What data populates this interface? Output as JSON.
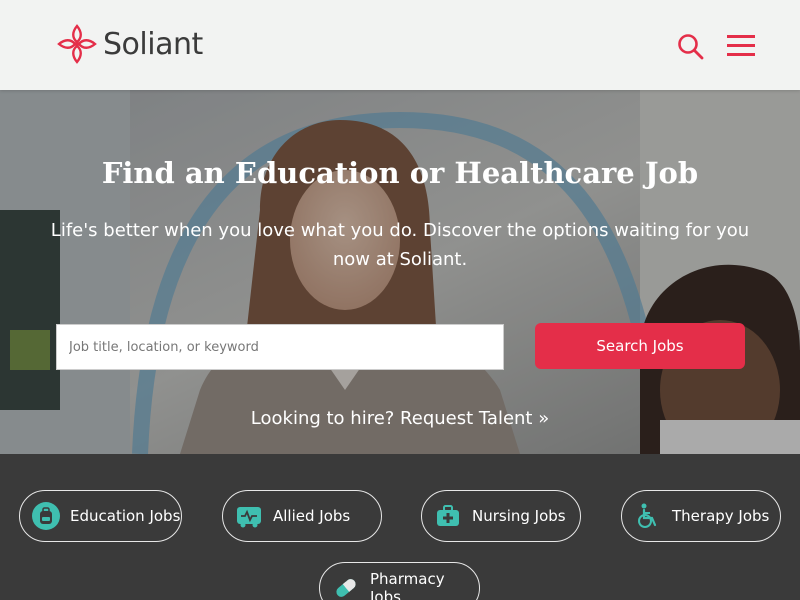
{
  "brand": {
    "name": "Soliant",
    "accent": "#e42e49",
    "teal": "#3fbfb0"
  },
  "header": {
    "search_icon": "search-icon",
    "menu_icon": "hamburger-menu-icon"
  },
  "hero": {
    "title": "Find an Education or Healthcare Job",
    "subtitle": "Life's better when you love what you do. Discover the options waiting for you now at Soliant.",
    "search": {
      "placeholder": "Job title, location, or keyword",
      "value": ""
    },
    "search_button": "Search Jobs",
    "hire_link": "Looking to hire? Request Talent »"
  },
  "categories": [
    {
      "label": "Education Jobs",
      "icon": "backpack-icon"
    },
    {
      "label": "Allied Jobs",
      "icon": "ambulance-icon"
    },
    {
      "label": "Nursing Jobs",
      "icon": "medical-kit-icon"
    },
    {
      "label": "Therapy Jobs",
      "icon": "wheelchair-icon"
    },
    {
      "label": "Pharmacy Jobs",
      "icon": "pill-icon"
    }
  ]
}
